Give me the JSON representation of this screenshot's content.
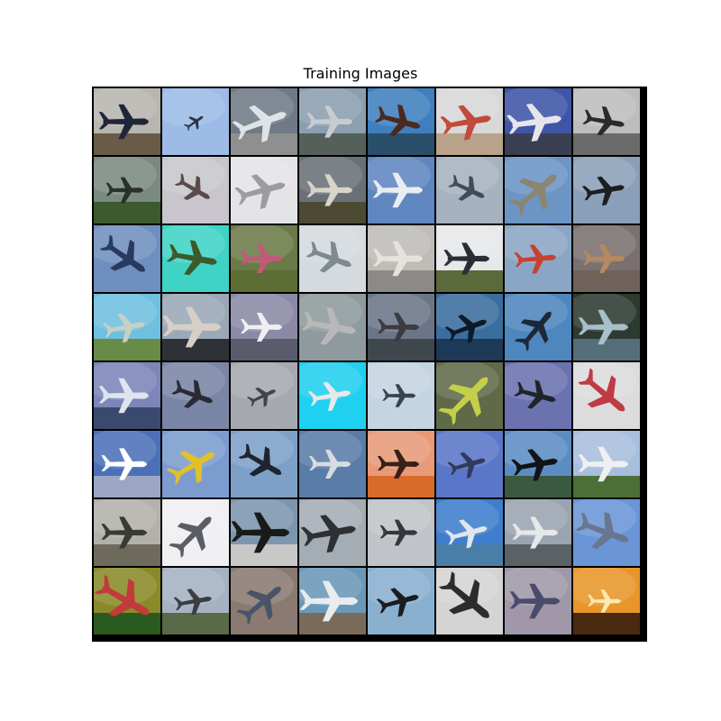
{
  "figure": {
    "title": "Training Images"
  },
  "grid": {
    "rows": 8,
    "cols": 8,
    "tiles": [
      {
        "sky": "#b9b6b0",
        "ground": "#6a5a48",
        "plane": "#20263a",
        "angle": 0,
        "scale": 1.2
      },
      {
        "sky": "#9dbbe6",
        "ground": null,
        "plane": "#2c3442",
        "angle": -35,
        "scale": 0.5
      },
      {
        "sky": "#6f7a86",
        "ground": "#8d8f90",
        "plane": "#dfe3e6",
        "angle": -20,
        "scale": 1.3
      },
      {
        "sky": "#8a9fb0",
        "ground": "#55605a",
        "plane": "#c8ccd0",
        "angle": 0,
        "scale": 1.1
      },
      {
        "sky": "#3f7fbf",
        "ground": "#2a4f6a",
        "plane": "#4a2a1e",
        "angle": 15,
        "scale": 1.1
      },
      {
        "sky": "#d8d8d8",
        "ground": "#b8a28a",
        "plane": "#c24a3a",
        "angle": -10,
        "scale": 1.2
      },
      {
        "sky": "#3e55a8",
        "ground": "#3a3f52",
        "plane": "#e6e6ea",
        "angle": -8,
        "scale": 1.3
      },
      {
        "sky": "#bdbdbd",
        "ground": "#6b6b6b",
        "plane": "#2b2b2b",
        "angle": 10,
        "scale": 1.0
      },
      {
        "sky": "#7a8a80",
        "ground": "#3b5a2e",
        "plane": "#2a3128",
        "angle": 0,
        "scale": 0.9
      },
      {
        "sky": "#c8c6cc",
        "ground": null,
        "plane": "#5a4a48",
        "angle": 30,
        "scale": 0.9
      },
      {
        "sky": "#e4e4e6",
        "ground": null,
        "plane": "#9a9ca2",
        "angle": -15,
        "scale": 1.2
      },
      {
        "sky": "#6a7078",
        "ground": "#4c4a32",
        "plane": "#d8d4c8",
        "angle": 0,
        "scale": 1.1
      },
      {
        "sky": "#5f86bf",
        "ground": null,
        "plane": "#e9edf2",
        "angle": 0,
        "scale": 1.2
      },
      {
        "sky": "#a6b2bf",
        "ground": null,
        "plane": "#404c5a",
        "angle": 25,
        "scale": 0.9
      },
      {
        "sky": "#6c95c6",
        "ground": null,
        "plane": "#8a8670",
        "angle": -40,
        "scale": 1.3
      },
      {
        "sky": "#8aa0b8",
        "ground": null,
        "plane": "#1e1e22",
        "angle": -10,
        "scale": 1.0
      },
      {
        "sky": "#6f8fc0",
        "ground": null,
        "plane": "#283a5e",
        "angle": 35,
        "scale": 1.2
      },
      {
        "sky": "#3fd3c6",
        "ground": null,
        "plane": "#3c5a2a",
        "angle": 10,
        "scale": 1.2
      },
      {
        "sky": "#6a7a48",
        "ground": "#5c6e34",
        "plane": "#c8567a",
        "angle": 0,
        "scale": 1.0
      },
      {
        "sky": "#d4dade",
        "ground": null,
        "plane": "#7e8a8e",
        "angle": 20,
        "scale": 1.1
      },
      {
        "sky": "#bfbcb8",
        "ground": "#8c8a86",
        "plane": "#e6e2dc",
        "angle": 0,
        "scale": 1.2
      },
      {
        "sky": "#e6e8ea",
        "ground": "#5a6a3a",
        "plane": "#2a2e34",
        "angle": 0,
        "scale": 1.1
      },
      {
        "sky": "#8aa6c4",
        "ground": null,
        "plane": "#c84032",
        "angle": -5,
        "scale": 1.0
      },
      {
        "sky": "#7a7070",
        "ground": "#6e625a",
        "plane": "#b48a5e",
        "angle": 0,
        "scale": 1.0
      },
      {
        "sky": "#6fc0e0",
        "ground": "#6a8a48",
        "plane": "#c8d0c4",
        "angle": -10,
        "scale": 1.0
      },
      {
        "sky": "#9aa8b8",
        "ground": "#2e3236",
        "plane": "#d8cec8",
        "angle": 0,
        "scale": 1.4
      },
      {
        "sky": "#8a8aa6",
        "ground": "#5a5c6e",
        "plane": "#f0eeee",
        "angle": 0,
        "scale": 1.0
      },
      {
        "sky": "#8e9a9e",
        "ground": null,
        "plane": "#b8b8b8",
        "angle": 10,
        "scale": 1.3
      },
      {
        "sky": "#6a7688",
        "ground": "#40464e",
        "plane": "#3a3c40",
        "angle": 0,
        "scale": 1.0
      },
      {
        "sky": "#3a6e9e",
        "ground": "#1c3a58",
        "plane": "#0e1a28",
        "angle": -20,
        "scale": 1.0
      },
      {
        "sky": "#4e86be",
        "ground": null,
        "plane": "#1c2838",
        "angle": -50,
        "scale": 1.1
      },
      {
        "sky": "#2c3a30",
        "ground": "#546e7a",
        "plane": "#a8c0c8",
        "angle": 0,
        "scale": 1.2
      },
      {
        "sky": "#7c86b8",
        "ground": "#3a4a6e",
        "plane": "#e0e4ee",
        "angle": 0,
        "scale": 1.2
      },
      {
        "sky": "#7a86a6",
        "ground": null,
        "plane": "#2a2a34",
        "angle": 20,
        "scale": 1.0
      },
      {
        "sky": "#a6aab0",
        "ground": null,
        "plane": "#404448",
        "angle": -25,
        "scale": 0.7
      },
      {
        "sky": "#20d0f0",
        "ground": null,
        "plane": "#e8e8ea",
        "angle": -10,
        "scale": 1.0
      },
      {
        "sky": "#c4d4e2",
        "ground": null,
        "plane": "#3a4450",
        "angle": 0,
        "scale": 0.8
      },
      {
        "sky": "#606a48",
        "ground": null,
        "plane": "#c4d04a",
        "angle": -45,
        "scale": 1.4
      },
      {
        "sky": "#6a72b0",
        "ground": null,
        "plane": "#202428",
        "angle": 15,
        "scale": 1.0
      },
      {
        "sky": "#dcdcdc",
        "ground": null,
        "plane": "#c03a44",
        "angle": 40,
        "scale": 1.3
      },
      {
        "sky": "#4c70b8",
        "ground": "#9aa6c4",
        "plane": "#ffffff",
        "angle": 0,
        "scale": 1.1
      },
      {
        "sky": "#7c9cd0",
        "ground": null,
        "plane": "#e2c02a",
        "angle": -30,
        "scale": 1.2
      },
      {
        "sky": "#7ea0c8",
        "ground": null,
        "plane": "#1e2430",
        "angle": 30,
        "scale": 1.1
      },
      {
        "sky": "#5a7ca8",
        "ground": null,
        "plane": "#d8dce0",
        "angle": 0,
        "scale": 1.0
      },
      {
        "sky": "#e89a78",
        "ground": "#d86a2a",
        "plane": "#3a2018",
        "angle": 0,
        "scale": 1.0
      },
      {
        "sky": "#5a76c8",
        "ground": null,
        "plane": "#303a5a",
        "angle": -15,
        "scale": 0.9
      },
      {
        "sky": "#5c8cc2",
        "ground": "#3a5a40",
        "plane": "#101418",
        "angle": -10,
        "scale": 1.1
      },
      {
        "sky": "#a8bedd",
        "ground": "#4a7038",
        "plane": "#f0f0f2",
        "angle": 0,
        "scale": 1.2
      },
      {
        "sky": "#b2b2aa",
        "ground": "#6e6a5c",
        "plane": "#3a3a36",
        "angle": 0,
        "scale": 1.1
      },
      {
        "sky": "#f0f0f2",
        "ground": null,
        "plane": "#5a5e64",
        "angle": -45,
        "scale": 1.2
      },
      {
        "sky": "#7c96b0",
        "ground": "#c8c8c8",
        "plane": "#1a1a1a",
        "angle": 0,
        "scale": 1.4
      },
      {
        "sky": "#a4acb4",
        "ground": null,
        "plane": "#2e3034",
        "angle": -10,
        "scale": 1.3
      },
      {
        "sky": "#c0c4c8",
        "ground": null,
        "plane": "#34383c",
        "angle": 0,
        "scale": 0.9
      },
      {
        "sky": "#3e7ecc",
        "ground": "#4a7ea6",
        "plane": "#e0e6ee",
        "angle": -15,
        "scale": 1.0
      },
      {
        "sky": "#9aa4b0",
        "ground": "#5a6268",
        "plane": "#e6e8ea",
        "angle": 0,
        "scale": 1.1
      },
      {
        "sky": "#6a96d8",
        "ground": null,
        "plane": "#6a7690",
        "angle": 20,
        "scale": 1.3
      },
      {
        "sky": "#8a8a2a",
        "ground": "#2a5a20",
        "plane": "#c23a3a",
        "angle": 30,
        "scale": 1.4
      },
      {
        "sky": "#a6b2c2",
        "ground": "#5a6a48",
        "plane": "#3a3e44",
        "angle": -10,
        "scale": 0.9
      },
      {
        "sky": "#8a7a72",
        "ground": null,
        "plane": "#4a5468",
        "angle": -40,
        "scale": 1.2
      },
      {
        "sky": "#6a98b8",
        "ground": "#7a6a5a",
        "plane": "#e8ecee",
        "angle": 0,
        "scale": 1.4
      },
      {
        "sky": "#8ab0d0",
        "ground": null,
        "plane": "#1a1c20",
        "angle": -15,
        "scale": 1.0
      },
      {
        "sky": "#d4d4d4",
        "ground": null,
        "plane": "#2c2c2c",
        "angle": 40,
        "scale": 1.4
      },
      {
        "sky": "#a098a8",
        "ground": null,
        "plane": "#4a4a6a",
        "angle": 0,
        "scale": 1.2
      },
      {
        "sky": "#e8962a",
        "ground": "#4a2a10",
        "plane": "#ffe8b0",
        "angle": 0,
        "scale": 0.8
      }
    ]
  }
}
